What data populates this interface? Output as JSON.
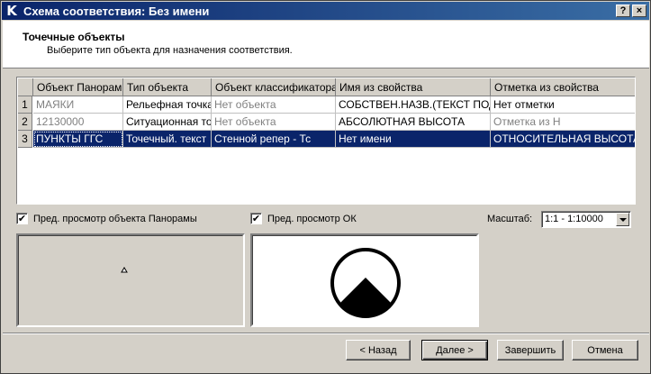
{
  "window": {
    "title": "Схема соответствия: Без имени",
    "app_letter": "K",
    "help_label": "?",
    "close_label": "×"
  },
  "header": {
    "title": "Точечные объекты",
    "subtitle": "Выберите тип объекта для назначения соответствия."
  },
  "table": {
    "columns": [
      "Объект Панорамы",
      "Тип объекта",
      "Объект классификатора",
      "Имя из свойства",
      "Отметка из свойства"
    ],
    "rows": [
      {
        "num": "1",
        "cells": [
          "МАЯКИ",
          "Рельефная точка",
          "Нет объекта",
          "СОБСТВЕН.НАЗВ.(ТЕКСТ ПОДПИСИ)",
          "Нет отметки"
        ]
      },
      {
        "num": "2",
        "cells": [
          "12130000",
          "Ситуационная точка",
          "Нет объекта",
          "АБСОЛЮТНАЯ ВЫСОТА",
          "Отметка из Н"
        ]
      },
      {
        "num": "3",
        "cells": [
          "ПУНКТЫ ГГС",
          "Точечный. текст",
          "Стенной репер - Тс",
          "Нет имени",
          "ОТНОСИТЕЛЬНАЯ ВЫСОТА"
        ]
      }
    ]
  },
  "options": {
    "preview_panorama": "Пред. просмотр объекта Панорамы",
    "preview_ok": "Пред. просмотр ОК",
    "scale_label": "Масштаб:",
    "scale_value": "1:1 - 1:10000",
    "check_glyph": "✔"
  },
  "buttons": {
    "back": "< Назад",
    "next": "Далее >",
    "finish": "Завершить",
    "cancel": "Отмена"
  }
}
